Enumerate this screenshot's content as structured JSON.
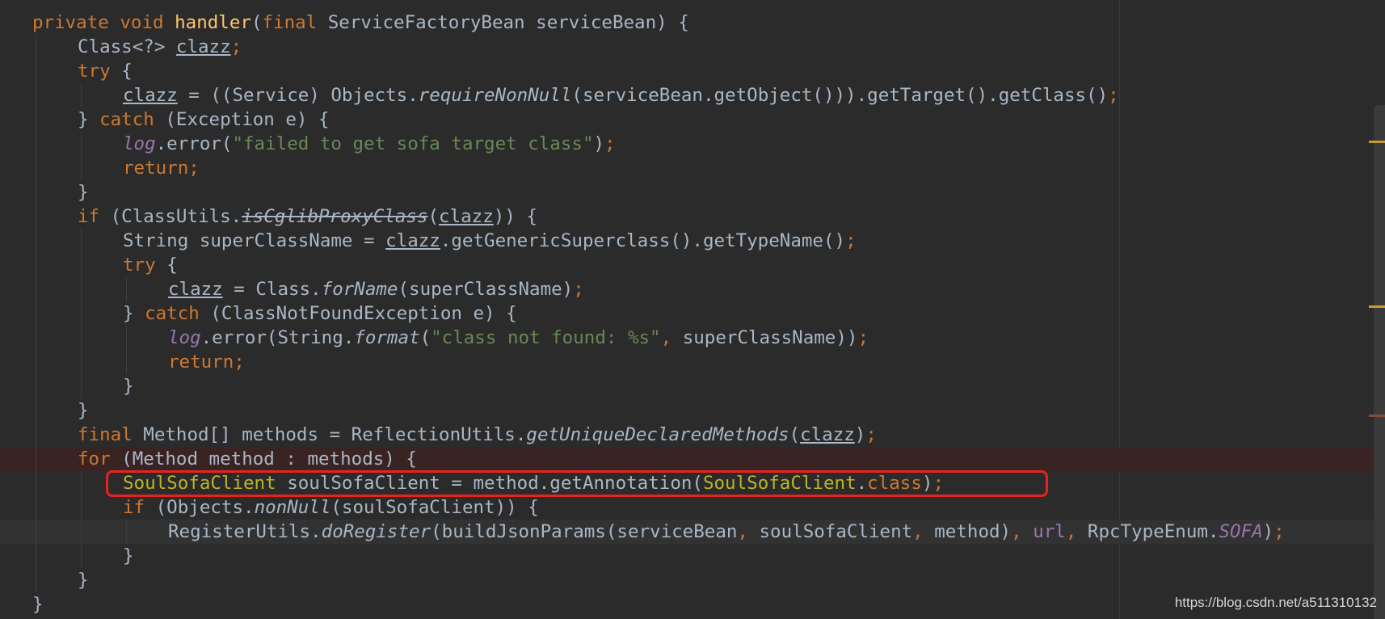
{
  "editor": {
    "lines": [
      [
        {
          "t": "private ",
          "c": "kw"
        },
        {
          "t": "void ",
          "c": "kw"
        },
        {
          "t": "handler",
          "c": "fn"
        },
        {
          "t": "("
        },
        {
          "t": "final ",
          "c": "kw"
        },
        {
          "t": "ServiceFactoryBean serviceBean) {"
        }
      ],
      [
        {
          "t": "Class<?> "
        },
        {
          "t": "clazz",
          "c": "ul"
        },
        {
          "t": ";",
          "c": "kw"
        }
      ],
      [
        {
          "t": "try ",
          "c": "kw"
        },
        {
          "t": "{"
        }
      ],
      [
        {
          "t": "clazz",
          "c": "ul"
        },
        {
          "t": " = ((Service) Objects."
        },
        {
          "t": "requireNonNull",
          "c": "it"
        },
        {
          "t": "(serviceBean.getObject())).getTarget().getClass()"
        },
        {
          "t": ";",
          "c": "kw"
        }
      ],
      [
        {
          "t": "} "
        },
        {
          "t": "catch ",
          "c": "kw"
        },
        {
          "t": "(Exception e) {"
        }
      ],
      [
        {
          "t": "log",
          "c": "fld"
        },
        {
          "t": ".error("
        },
        {
          "t": "\"failed to get sofa target class\"",
          "c": "str"
        },
        {
          "t": ")"
        },
        {
          "t": ";",
          "c": "kw"
        }
      ],
      [
        {
          "t": "return;",
          "c": "kw"
        }
      ],
      [
        {
          "t": "}"
        }
      ],
      [
        {
          "t": "if ",
          "c": "kw"
        },
        {
          "t": "(ClassUtils."
        },
        {
          "t": "isCglibProxyClass",
          "c": "strike"
        },
        {
          "t": "("
        },
        {
          "t": "clazz",
          "c": "ul"
        },
        {
          "t": ")) {"
        }
      ],
      [
        {
          "t": "String superClassName = "
        },
        {
          "t": "clazz",
          "c": "ul"
        },
        {
          "t": ".getGenericSuperclass().getTypeName()"
        },
        {
          "t": ";",
          "c": "kw"
        }
      ],
      [
        {
          "t": "try ",
          "c": "kw"
        },
        {
          "t": "{"
        }
      ],
      [
        {
          "t": "clazz",
          "c": "ul"
        },
        {
          "t": " = Class."
        },
        {
          "t": "forName",
          "c": "it"
        },
        {
          "t": "(superClassName)"
        },
        {
          "t": ";",
          "c": "kw"
        }
      ],
      [
        {
          "t": "} "
        },
        {
          "t": "catch ",
          "c": "kw"
        },
        {
          "t": "(ClassNotFoundException e) {"
        }
      ],
      [
        {
          "t": "log",
          "c": "fld"
        },
        {
          "t": ".error(String."
        },
        {
          "t": "format",
          "c": "it"
        },
        {
          "t": "("
        },
        {
          "t": "\"class not found: %s\"",
          "c": "str"
        },
        {
          "t": ", ",
          "c": "kw"
        },
        {
          "t": "superClassName))"
        },
        {
          "t": ";",
          "c": "kw"
        }
      ],
      [
        {
          "t": "return;",
          "c": "kw"
        }
      ],
      [
        {
          "t": "}"
        }
      ],
      [
        {
          "t": "}"
        }
      ],
      [
        {
          "t": "final ",
          "c": "kw"
        },
        {
          "t": "Method[] methods = ReflectionUtils."
        },
        {
          "t": "getUniqueDeclaredMethods",
          "c": "it"
        },
        {
          "t": "("
        },
        {
          "t": "clazz",
          "c": "ul"
        },
        {
          "t": ")"
        },
        {
          "t": ";",
          "c": "kw"
        }
      ],
      [
        {
          "t": "for ",
          "c": "kw"
        },
        {
          "t": "(Method method : methods) {"
        }
      ],
      [
        {
          "t": "SoulSofaClient",
          "c": "ann"
        },
        {
          "t": " soulSofaClient = method.getAnnotation("
        },
        {
          "t": "SoulSofaClient",
          "c": "ann"
        },
        {
          "t": "."
        },
        {
          "t": "class",
          "c": "kw"
        },
        {
          "t": ")"
        },
        {
          "t": ";",
          "c": "kw"
        }
      ],
      [
        {
          "t": "if ",
          "c": "kw"
        },
        {
          "t": "(Objects."
        },
        {
          "t": "nonNull",
          "c": "it"
        },
        {
          "t": "(soulSofaClient)) {"
        }
      ],
      [
        {
          "t": "RegisterUtils."
        },
        {
          "t": "doRegister",
          "c": "it"
        },
        {
          "t": "(buildJsonParams(serviceBean"
        },
        {
          "t": ", ",
          "c": "kw"
        },
        {
          "t": "soulSofaClient"
        },
        {
          "t": ", ",
          "c": "kw"
        },
        {
          "t": "method)"
        },
        {
          "t": ", ",
          "c": "kw"
        },
        {
          "t": "url",
          "c": "param"
        },
        {
          "t": ", ",
          "c": "kw"
        },
        {
          "t": "RpcTypeEnum."
        },
        {
          "t": "SOFA",
          "c": "cst"
        },
        {
          "t": ")"
        },
        {
          "t": ";",
          "c": "kw"
        }
      ],
      [
        {
          "t": "}"
        }
      ],
      [
        {
          "t": "}"
        }
      ],
      [
        {
          "t": "}"
        }
      ]
    ]
  },
  "watermark": "https://blog.csdn.net/a511310132"
}
